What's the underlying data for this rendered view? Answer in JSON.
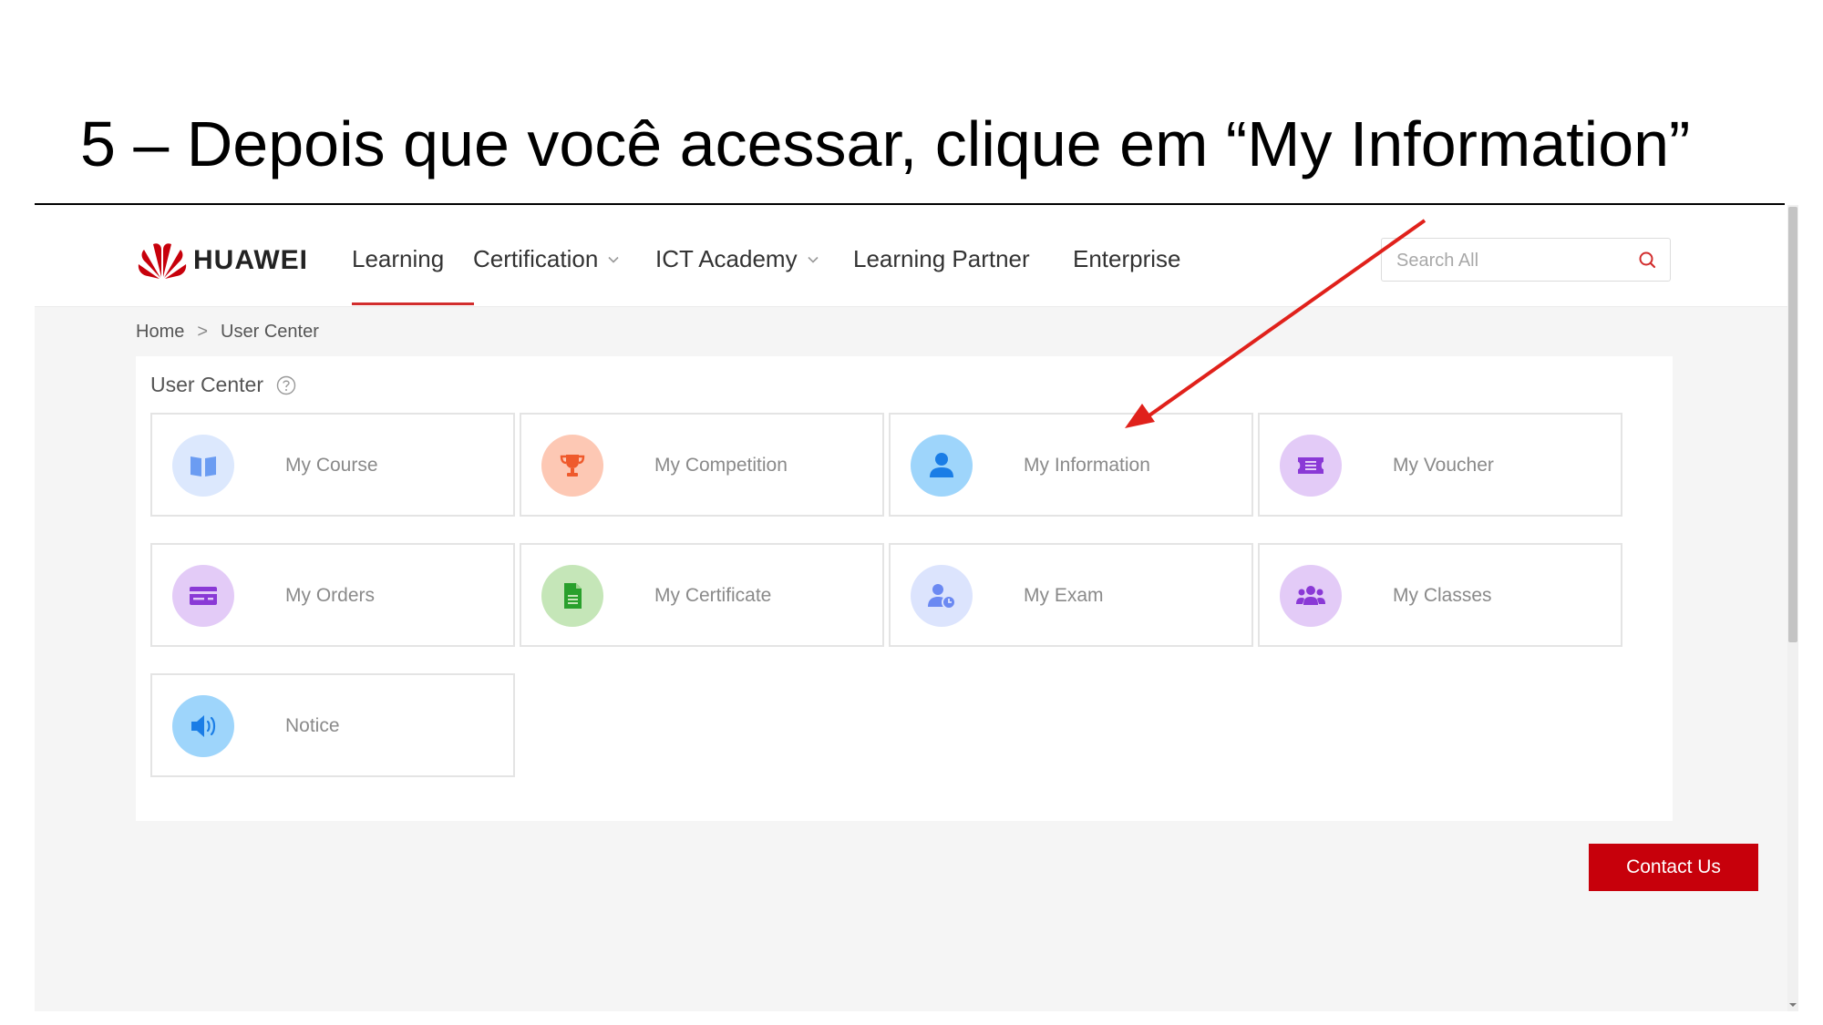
{
  "slide": {
    "title": "5 – Depois que você acessar,  clique em “My Information”"
  },
  "brand": {
    "name": "HUAWEI",
    "logo_icon": "huawei-petals-logo",
    "accent": "#c7000b"
  },
  "nav": {
    "items": [
      {
        "label": "Learning",
        "active": true
      },
      {
        "label": "Certification",
        "dropdown": true
      },
      {
        "label": "ICT Academy",
        "dropdown": true
      },
      {
        "label": "Learning Partner"
      },
      {
        "label": "Enterprise"
      }
    ],
    "search_placeholder": "Search All",
    "search_icon": "search-icon"
  },
  "breadcrumb": {
    "items": [
      "Home",
      "User Center"
    ],
    "separator": ">"
  },
  "user_center": {
    "title": "User Center",
    "help_icon": "question-circle-icon",
    "cards": [
      {
        "label": "My Course",
        "icon": "book-icon",
        "color": "#6b9cf2",
        "bg": "#dce8fd"
      },
      {
        "label": "My Competition",
        "icon": "trophy-icon",
        "color": "#ef5a2c",
        "bg": "#fdc8b4"
      },
      {
        "label": "My Information",
        "icon": "user-icon",
        "color": "#1a7de6",
        "bg": "#9ed5fb"
      },
      {
        "label": "My Voucher",
        "icon": "ticket-icon",
        "color": "#8a39d6",
        "bg": "#e3cbf7"
      },
      {
        "label": "My Orders",
        "icon": "card-icon",
        "color": "#8a39d6",
        "bg": "#e3cbf7"
      },
      {
        "label": "My Certificate",
        "icon": "document-icon",
        "color": "#29a02c",
        "bg": "#c5e6b8"
      },
      {
        "label": "My Exam",
        "icon": "user-clock-icon",
        "color": "#6b89f2",
        "bg": "#dce4fd"
      },
      {
        "label": "My Classes",
        "icon": "users-icon",
        "color": "#8a39d6",
        "bg": "#e3cbf7"
      },
      {
        "label": "Notice",
        "icon": "speaker-icon",
        "color": "#1a7de6",
        "bg": "#9ed5fb"
      }
    ]
  },
  "contact_button": {
    "label": "Contact Us"
  },
  "annotation": {
    "arrow_color": "#e0211b",
    "target": "My Information"
  }
}
